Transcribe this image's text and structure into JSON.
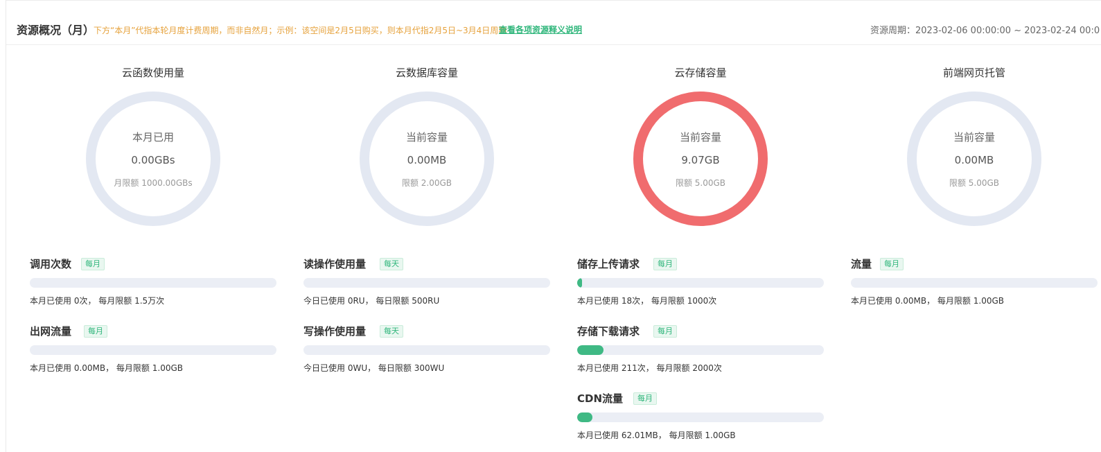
{
  "header": {
    "title": "资源概况（月）",
    "notice": "下方“本月”代指本轮月度计费周期，而非自然月；示例：该空间是2月5日购买，则本月代指2月5日~3月4日周期",
    "explain_link": "查看各项资源释义说明",
    "period": "资源周期：2023-02-06 00:00:00 ~ 2023-02-24 00:0"
  },
  "colors": {
    "accent": "#3fb984",
    "ring_track": "#e3e8f2",
    "ring_over": "#f06c6e",
    "notice": "#e6a23c"
  },
  "columns": [
    {
      "title": "云函数使用量",
      "ring": {
        "label": "本月已用",
        "value": "0.00GBs",
        "limit": "月限额 1000.00GBs",
        "over": false
      },
      "metrics": [
        {
          "name": "调用次数",
          "badge": "每月",
          "fraction": 0,
          "desc": "本月已使用 0次， 每月限额 1.5万次"
        },
        {
          "name": "出网流量",
          "badge": "每月",
          "fraction": 0,
          "desc": "本月已使用 0.00MB， 每月限额 1.00GB"
        }
      ]
    },
    {
      "title": "云数据库容量",
      "ring": {
        "label": "当前容量",
        "value": "0.00MB",
        "limit": "限额 2.00GB",
        "over": false
      },
      "metrics": [
        {
          "name": "读操作使用量",
          "badge": "每天",
          "fraction": 0,
          "desc": "今日已使用 0RU， 每日限额 500RU"
        },
        {
          "name": "写操作使用量",
          "badge": "每天",
          "fraction": 0,
          "desc": "今日已使用 0WU， 每日限额 300WU"
        }
      ]
    },
    {
      "title": "云存储容量",
      "ring": {
        "label": "当前容量",
        "value": "9.07GB",
        "limit": "限额 5.00GB",
        "over": true
      },
      "metrics": [
        {
          "name": "储存上传请求",
          "badge": "每月",
          "fraction": 0.018,
          "desc": "本月已使用 18次， 每月限额 1000次"
        },
        {
          "name": "存储下载请求",
          "badge": "每月",
          "fraction": 0.1055,
          "desc": "本月已使用 211次， 每月限额 2000次"
        },
        {
          "name": "CDN流量",
          "badge": "每月",
          "fraction": 0.0606,
          "desc": "本月已使用 62.01MB， 每月限额 1.00GB"
        }
      ]
    },
    {
      "title": "前端网页托管",
      "ring": {
        "label": "当前容量",
        "value": "0.00MB",
        "limit": "限额 5.00GB",
        "over": false
      },
      "metrics": [
        {
          "name": "流量",
          "badge": "每月",
          "fraction": 0,
          "desc": "本月已使用 0.00MB， 每月限额 1.00GB"
        }
      ]
    }
  ]
}
